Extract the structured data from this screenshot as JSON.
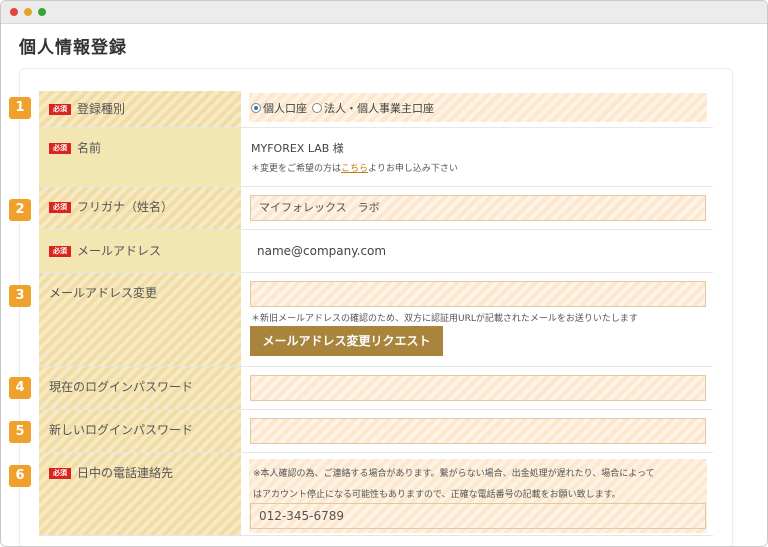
{
  "page_title": "個人情報登録",
  "required_badge": "必須",
  "rows": {
    "account_type": {
      "step": "1",
      "label": "登録種別",
      "options": [
        "個人口座",
        "法人・個人事業主口座"
      ],
      "selected": "個人口座"
    },
    "name": {
      "label": "名前",
      "value": "MYFOREX LAB 様",
      "note_prefix": "＊変更をご希望の方は",
      "note_link": "こちら",
      "note_suffix": "よりお申し込み下さい"
    },
    "furigana": {
      "step": "2",
      "label": "フリガナ（姓名）",
      "value": "マイフォレックス　ラボ"
    },
    "email": {
      "label": "メールアドレス",
      "value": "name@company.com"
    },
    "email_change": {
      "step": "3",
      "label": "メールアドレス変更",
      "value": "",
      "note": "＊新旧メールアドレスの確認のため、双方に認証用URLが記載されたメールをお送りいたします",
      "button_label": "メールアドレス変更リクエスト"
    },
    "current_password": {
      "step": "4",
      "label": "現在のログインパスワード",
      "value": ""
    },
    "new_password": {
      "step": "5",
      "label": "新しいログインパスワード",
      "value": ""
    },
    "daytime_phone": {
      "step": "6",
      "label": "日中の電話連絡先",
      "note_line1": "※本人確認の為、ご連絡する場合があります。繋がらない場合、出金処理が遅れたり、場合によって",
      "note_line2": "はアカウント停止になる可能性もありますので、正確な電話番号の記載をお願い致します。",
      "value": "012-345-6789"
    }
  },
  "colors": {
    "step_badge": "#f0a12b",
    "required_badge": "#d9251d",
    "button": "#a8843c",
    "label_bg": "#f2e7b3"
  }
}
